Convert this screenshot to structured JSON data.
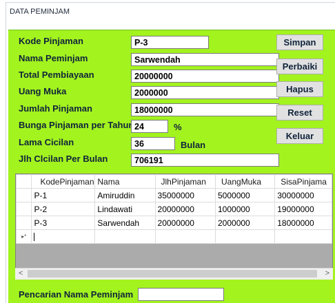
{
  "window": {
    "title": "DATA PEMINJAM"
  },
  "form": {
    "kode_label": "Kode Pinjaman",
    "kode_value": "P-3",
    "nama_label": "Nama Peminjam",
    "nama_value": "Sarwendah",
    "total_label": "Total Pembiayaan",
    "total_value": "20000000",
    "uang_muka_label": "Uang Muka",
    "uang_muka_value": "2000000",
    "jumlah_label": "Jumlah Pinjaman",
    "jumlah_value": "18000000",
    "bunga_label": "Bunga Pinjaman per Tahun",
    "bunga_value": "24",
    "bunga_unit": "%",
    "lama_label": "Lama Cicilan",
    "lama_value": "36",
    "lama_unit": "Bulan",
    "cicilan_label": "Jlh Clcilan Per Bulan",
    "cicilan_value": "706191",
    "search_label": "Pencarian Nama Peminjam",
    "search_value": ""
  },
  "buttons": {
    "simpan": "Simpan",
    "perbaiki": "Perbaiki",
    "hapus": "Hapus",
    "reset": "Reset",
    "keluar": "Keluar"
  },
  "grid": {
    "columns": [
      "KodePinjaman",
      "Nama",
      "JlhPinjaman",
      "UangMuka",
      "SisaPinjama"
    ],
    "rows": [
      [
        "P-1",
        "Amiruddin",
        "35000000",
        "5000000",
        "30000000"
      ],
      [
        "P-2",
        "Lindawati",
        "20000000",
        "1000000",
        "19000000"
      ],
      [
        "P-3",
        "Sarwendah",
        "20000000",
        "2000000",
        "18000000"
      ]
    ],
    "new_row_marker": "▸*",
    "scroll_left": "<",
    "scroll_right": ">"
  }
}
